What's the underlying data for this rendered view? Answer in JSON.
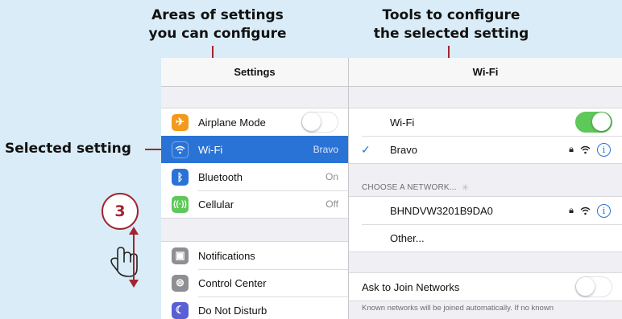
{
  "callouts": {
    "areas_line1": "Areas of settings",
    "areas_line2": "you can configure",
    "tools_line1": "Tools to configure",
    "tools_line2": "the selected setting",
    "selected": "Selected setting",
    "step_number": "3"
  },
  "left_panel": {
    "title": "Settings",
    "group1": [
      {
        "label": "Airplane Mode",
        "icon": "airplane-icon",
        "color": "#f39a1e",
        "toggle": false
      },
      {
        "label": "Wi-Fi",
        "detail": "Bravo",
        "icon": "wifi-icon",
        "color": "#2a73d6",
        "selected": true
      },
      {
        "label": "Bluetooth",
        "detail": "On",
        "icon": "bluetooth-icon",
        "color": "#2a73d6"
      },
      {
        "label": "Cellular",
        "detail": "Off",
        "icon": "cellular-icon",
        "color": "#5fc85a"
      }
    ],
    "group2": [
      {
        "label": "Notifications",
        "icon": "notifications-icon",
        "color": "#8e8e93"
      },
      {
        "label": "Control Center",
        "icon": "control-center-icon",
        "color": "#8e8e93"
      },
      {
        "label": "Do Not Disturb",
        "icon": "moon-icon",
        "color": "#5a5fd6"
      }
    ]
  },
  "right_panel": {
    "title": "Wi-Fi",
    "wifi_label": "Wi-Fi",
    "wifi_on": true,
    "connected_network": "Bravo",
    "section_header": "CHOOSE A NETWORK...",
    "networks": [
      "BHNDVW3201B9DA0"
    ],
    "other_label": "Other...",
    "ask_to_join_label": "Ask to Join Networks",
    "ask_to_join_on": false,
    "footer": "Known networks will be joined automatically. If no known"
  },
  "colors": {
    "accent_red": "#a3242f",
    "ios_blue": "#2a73d6",
    "toggle_green": "#5fc85a",
    "background": "#d9ecf7"
  }
}
